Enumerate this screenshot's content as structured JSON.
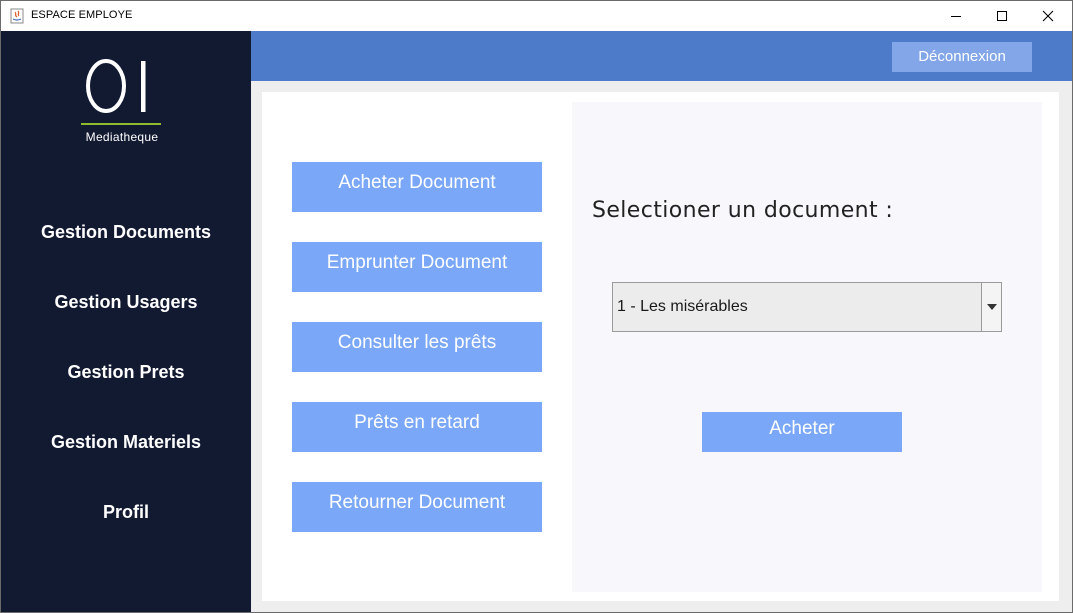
{
  "window": {
    "title": "ESPACE EMPLOYE",
    "controls": [
      "minimize-icon",
      "maximize-icon",
      "close-icon"
    ]
  },
  "sidebar": {
    "logo_caption": "Mediatheque",
    "items": [
      {
        "label": "Gestion Documents"
      },
      {
        "label": "Gestion Usagers"
      },
      {
        "label": "Gestion Prets"
      },
      {
        "label": "Gestion Materiels"
      },
      {
        "label": "Profil"
      }
    ]
  },
  "header": {
    "logout_label": "Déconnexion"
  },
  "actions": [
    {
      "label": "Acheter Document"
    },
    {
      "label": "Emprunter Document"
    },
    {
      "label": "Consulter les prêts"
    },
    {
      "label": "Prêts en retard"
    },
    {
      "label": "Retourner Document"
    }
  ],
  "panel": {
    "prompt": "Selectioner un document :",
    "selected_document": "1 - Les misérables",
    "submit_label": "Acheter"
  },
  "colors": {
    "sidebar_bg": "#121a32",
    "topbar_bg": "#4d7bc9",
    "button_bg": "#7aa7f7",
    "logout_bg": "#82a6e8",
    "logo_accent": "#8fbc2f"
  }
}
